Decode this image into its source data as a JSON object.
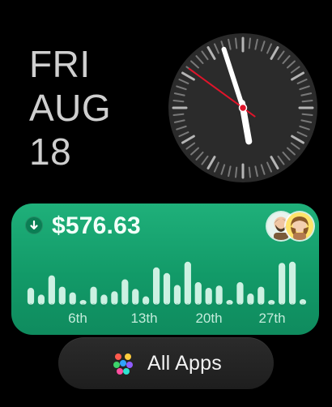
{
  "date": {
    "weekday": "FRI",
    "month": "AUG",
    "day": "18"
  },
  "clock": {
    "hour_hand_minutes": 340,
    "minute_hand_minutes": 57,
    "second_hand_minutes": 51
  },
  "finance": {
    "trend_icon": "down-arrow-icon",
    "amount": "$576.63",
    "chart_data": {
      "type": "bar",
      "title": "",
      "x_labels": [
        "6th",
        "13th",
        "20th",
        "27th"
      ],
      "values": [
        0.3,
        0.18,
        0.52,
        0.32,
        0.22,
        0.05,
        0.32,
        0.18,
        0.24,
        0.45,
        0.28,
        0.15,
        0.66,
        0.56,
        0.35,
        0.76,
        0.4,
        0.3,
        0.34,
        0.08,
        0.4,
        0.2,
        0.32,
        0.06,
        0.74,
        0.76,
        0.1
      ]
    },
    "colors": {
      "card": "#14a06b",
      "bar": "#d7f6e9",
      "axis_label": "#d7f6e9"
    }
  },
  "all_apps": {
    "label": "All Apps",
    "icon": "app-grid-icon"
  }
}
